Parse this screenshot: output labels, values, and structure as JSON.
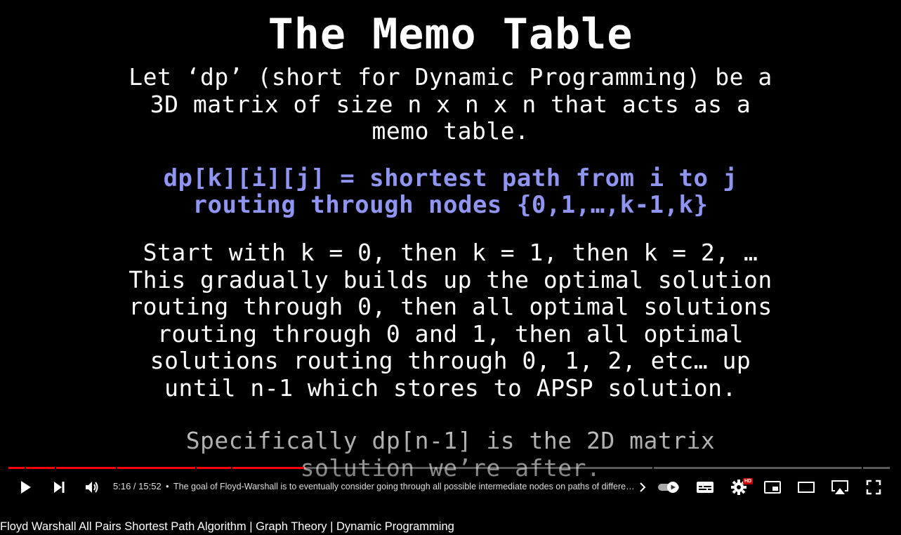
{
  "slide": {
    "title": "The Memo Table",
    "paragraph1": "Let ‘dp’ (short for Dynamic Programming) be a\n3D matrix of size n x n x n that acts as a\nmemo table.",
    "definition": "dp[k][i][j] = shortest path from i to j\nrouting through nodes {0,1,…,k-1,k}",
    "paragraph3": "Start with k = 0, then k = 1, then k = 2, …\nThis gradually builds up the optimal solution\nrouting through 0, then all optimal solutions\nrouting through 0 and 1, then all optimal\nsolutions routing through 0, 1, 2, etc… up\nuntil n-1 which stores to APSP solution.",
    "paragraph4": "Specifically dp[n-1] is the 2D matrix\nsolution we’re after."
  },
  "player": {
    "current_time": "5:16",
    "duration": "15:52",
    "time_display": "5:16 / 15:52",
    "separator": "•",
    "chapter_title": "The goal of Floyd-Warshall is to eventually consider going through all possible intermediate nodes on paths of different lengths",
    "progress_fraction": 0.332,
    "hd_badge": "HD",
    "colors": {
      "progress": "#ff0000",
      "hd_badge": "#cc0000",
      "definition_text": "#8f95f0"
    },
    "icons": [
      "play-icon",
      "next-icon",
      "volume-icon",
      "chevron-right-icon",
      "autoplay-toggle-icon",
      "subtitles-icon",
      "settings-icon",
      "miniplayer-icon",
      "theater-mode-icon",
      "airplay-icon",
      "fullscreen-icon"
    ]
  },
  "video": {
    "title": "Floyd Warshall All Pairs Shortest Path Algorithm | Graph Theory | Dynamic Programming"
  }
}
